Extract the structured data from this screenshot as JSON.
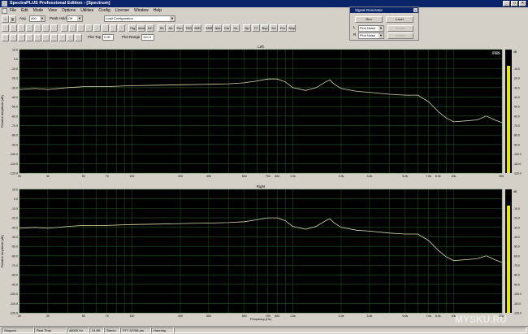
{
  "window": {
    "title": "SpectraPLUS Professional Edition - [Spectrum]"
  },
  "menu": [
    "File",
    "Edit",
    "Mode",
    "View",
    "Options",
    "Utilities",
    "Config",
    "License",
    "Window",
    "Help"
  ],
  "toolbar": {
    "avg_label": "Avg",
    "avg_value": "400",
    "peak_hold_label": "Peak Hold",
    "peak_hold_value": "Off",
    "config_value": "Load Configuration",
    "plot_top_label": "Plot Top",
    "plot_top_value": "0.00",
    "plot_range_label": "Plot Range",
    "plot_range_value": "120.0",
    "buttons": [
      "Trig",
      "Mod",
      "DC",
      "Sb",
      "Ab",
      "Pen",
      "THD",
      "IMD",
      "SNR",
      "Nse",
      "Cal",
      "Hz",
      "Dp",
      "Ft",
      "Bsp",
      "Kd",
      "Pro",
      "Stop"
    ]
  },
  "signal_generator": {
    "title": "Signal Generator",
    "run_label": "Run",
    "level_label": "Level",
    "left_channel": "L",
    "right_channel": "R",
    "left_type": "Pink Noise",
    "right_type": "Pink Noise",
    "disabled_label": "Details"
  },
  "plots": [
    {
      "title": "Left",
      "y_axis_label": "Relative Amplitude (dB)"
    },
    {
      "title": "Right",
      "y_axis_label": "Relative Amplitude (dB)"
    }
  ],
  "axes": {
    "y_ticks": [
      "10.0",
      "0.0",
      "-10.0",
      "-20.0",
      "-30.0",
      "-40.0",
      "-50.0",
      "-60.0",
      "-70.0",
      "-80.0",
      "-90.0",
      "-100.0",
      "-110.0",
      "-120.0"
    ],
    "x_ticks": [
      "20",
      "30",
      "50",
      "70",
      "100",
      "200",
      "300",
      "500",
      "700",
      "800",
      "1.0k",
      "2.0k",
      "3.0k",
      "5.0k",
      "7.0k",
      "8.0k",
      "10k",
      "20k",
      "Freq"
    ],
    "x_label": "Frequency (Hz)",
    "meter_ticks": [
      "-10.0",
      "-20.0",
      "-30.0",
      "-40.0",
      "-50.0",
      "-60.0",
      "-70.0",
      "-80.0",
      "-90.0",
      "-100.0",
      "-110.0",
      "-120.0"
    ],
    "meter_top_label": "dB"
  },
  "brand_overlay": "FHS",
  "watermark": "MYSKU.RU",
  "colors": {
    "plot_bg": "#000000",
    "grid": "#1f5a1f",
    "trace": "#d9d9a8",
    "meter": "#e8e800",
    "titlebar": "#0a246a"
  },
  "status": {
    "state": "Stopped",
    "mode": "Real Time",
    "rate": "48000 Hz",
    "bits": "24 Bit",
    "channels": "Stereo",
    "fft": "FFT 32768 pts",
    "window": "Hanning"
  },
  "chart_data": [
    {
      "type": "line",
      "title": "Left",
      "xlabel": "Frequency (Hz)",
      "ylabel": "Relative Amplitude (dB)",
      "xscale": "log",
      "xlim": [
        20,
        20000
      ],
      "ylim": [
        -120,
        10
      ],
      "grid": true,
      "series": [
        {
          "x": [
            20,
            25,
            30,
            40,
            50,
            70,
            100,
            150,
            200,
            300,
            400,
            500,
            600,
            700,
            800,
            900,
            1000,
            1200,
            1400,
            1600,
            1700,
            1800,
            2000,
            2500,
            3000,
            4000,
            5000,
            6000,
            7000,
            8000,
            9000,
            10000,
            12000,
            14000,
            16000,
            18000,
            20000
          ],
          "y": [
            -32,
            -31,
            -32,
            -30,
            -29,
            -29,
            -28,
            -27.5,
            -27,
            -26.5,
            -26,
            -25,
            -23,
            -21,
            -21,
            -24,
            -30,
            -33,
            -30,
            -24,
            -22,
            -26,
            -31,
            -34,
            -35,
            -37,
            -38,
            -38,
            -45,
            -55,
            -62,
            -66,
            -65,
            -64,
            -60,
            -64,
            -67
          ]
        }
      ]
    },
    {
      "type": "line",
      "title": "Right",
      "xlabel": "Frequency (Hz)",
      "ylabel": "Relative Amplitude (dB)",
      "xscale": "log",
      "xlim": [
        20,
        20000
      ],
      "ylim": [
        -120,
        10
      ],
      "grid": true,
      "series": [
        {
          "x": [
            20,
            25,
            30,
            40,
            50,
            70,
            100,
            150,
            200,
            300,
            400,
            500,
            600,
            700,
            800,
            900,
            1000,
            1200,
            1400,
            1600,
            1700,
            1800,
            2000,
            2500,
            3000,
            4000,
            5000,
            6000,
            7000,
            8000,
            9000,
            10000,
            12000,
            14000,
            16000,
            18000,
            20000
          ],
          "y": [
            -31,
            -30,
            -31,
            -29,
            -28,
            -28,
            -27,
            -26.5,
            -26,
            -25.5,
            -25,
            -24,
            -22,
            -20,
            -20,
            -23,
            -29,
            -32,
            -29,
            -23,
            -21,
            -25,
            -30,
            -33,
            -34,
            -36,
            -37,
            -37,
            -44,
            -54,
            -61,
            -65,
            -64,
            -63,
            -60,
            -64,
            -67
          ]
        }
      ]
    }
  ]
}
